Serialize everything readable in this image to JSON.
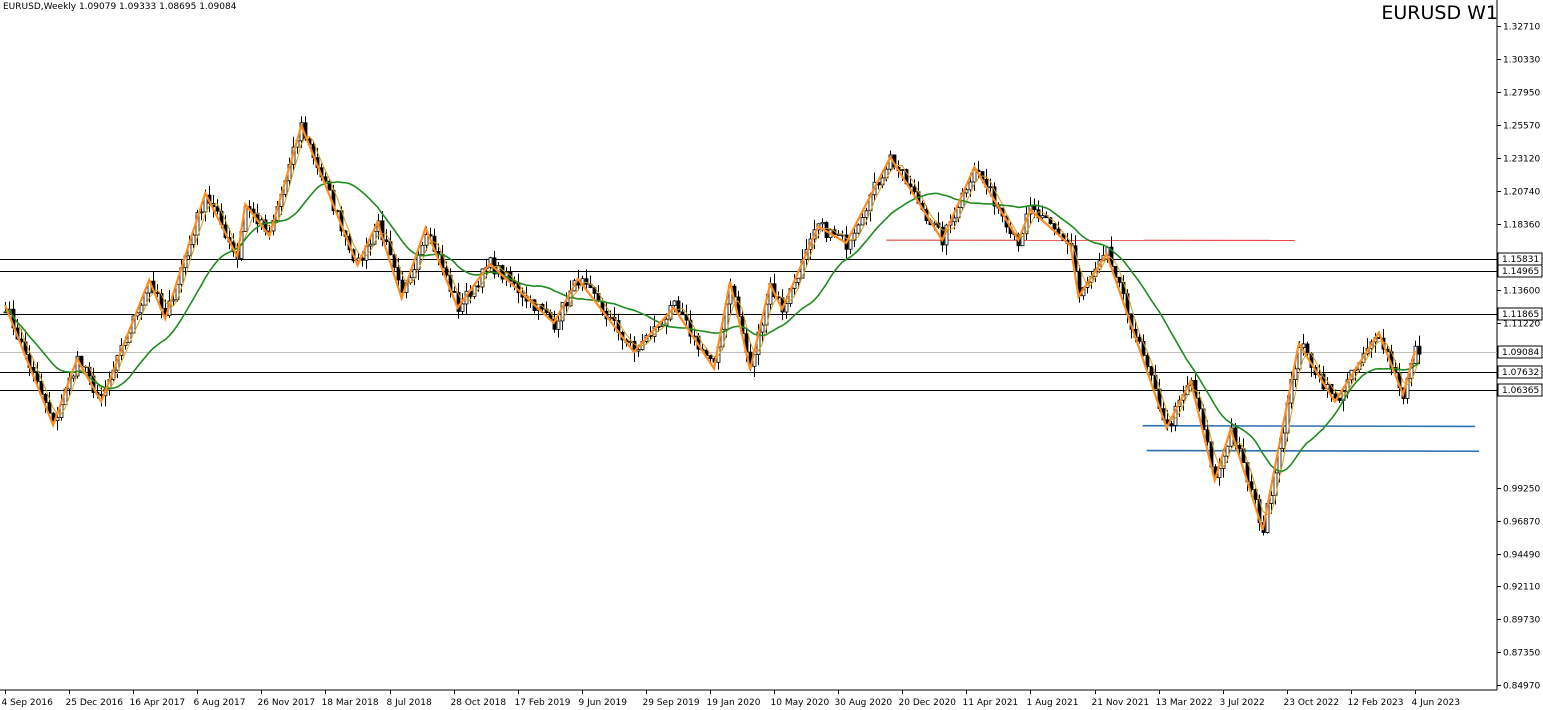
{
  "header": {
    "symbol_line": "EURUSD,Weekly  1.09079 1.09333 1.08695 1.09084",
    "watermark": "EURUSD W1"
  },
  "colors": {
    "candle": "#000000",
    "zigzag": "#ff8c1a",
    "ma_slow": "#1e8c1e",
    "ma_fast": "#d4a017",
    "hline": "#000000",
    "current_line": "#c0c0c0",
    "red_line": "#e03030",
    "blue_line": "#2f6fb0"
  },
  "chart_data": {
    "type": "line",
    "title": "EURUSD W1",
    "ylim": [
      0.846,
      1.346
    ],
    "yticks": [
      "1.32710",
      "1.30330",
      "1.27950",
      "1.25570",
      "1.23120",
      "1.20740",
      "1.18360",
      "1.13600",
      "1.11220",
      "0.99250",
      "0.96870",
      "0.94490",
      "0.92110",
      "0.89730",
      "0.87350",
      "0.84970"
    ],
    "xticks": [
      {
        "label": "4 Sep 2016",
        "t": 0
      },
      {
        "label": "25 Dec 2016",
        "t": 16
      },
      {
        "label": "16 Apr 2017",
        "t": 32
      },
      {
        "label": "6 Aug 2017",
        "t": 48
      },
      {
        "label": "26 Nov 2017",
        "t": 64
      },
      {
        "label": "18 Mar 2018",
        "t": 80
      },
      {
        "label": "8 Jul 2018",
        "t": 96
      },
      {
        "label": "28 Oct 2018",
        "t": 112
      },
      {
        "label": "17 Feb 2019",
        "t": 128
      },
      {
        "label": "9 Jun 2019",
        "t": 144
      },
      {
        "label": "29 Sep 2019",
        "t": 160
      },
      {
        "label": "19 Jan 2020",
        "t": 176
      },
      {
        "label": "10 May 2020",
        "t": 192
      },
      {
        "label": "30 Aug 2020",
        "t": 208
      },
      {
        "label": "20 Dec 2020",
        "t": 224
      },
      {
        "label": "11 Apr 2021",
        "t": 240
      },
      {
        "label": "1 Aug 2021",
        "t": 256
      },
      {
        "label": "21 Nov 2021",
        "t": 272
      },
      {
        "label": "13 Mar 2022",
        "t": 288
      },
      {
        "label": "3 Jul 2022",
        "t": 304
      },
      {
        "label": "23 Oct 2022",
        "t": 320
      },
      {
        "label": "12 Feb 2023",
        "t": 336
      },
      {
        "label": "4 Jun 2023",
        "t": 352
      }
    ],
    "horizontal_levels": [
      {
        "label": "1.15831",
        "value": 1.15831,
        "style": "black",
        "t_start": 0,
        "t_end": 364
      },
      {
        "label": "1.14965",
        "value": 1.14965,
        "style": "black",
        "t_start": 0,
        "t_end": 364
      },
      {
        "label": "1.11865",
        "value": 1.11865,
        "style": "black",
        "t_start": 0,
        "t_end": 364
      },
      {
        "label": "1.09084",
        "value": 1.09084,
        "style": "current",
        "t_start": 0,
        "t_end": 364
      },
      {
        "label": "1.07632",
        "value": 1.07632,
        "style": "black",
        "t_start": 0,
        "t_end": 364
      },
      {
        "label": "1.06365",
        "value": 1.06365,
        "style": "black",
        "t_start": 0,
        "t_end": 364
      }
    ],
    "trend_lines": [
      {
        "style": "red",
        "t1": 220,
        "v1": 1.172,
        "t2": 322,
        "v2": 1.1718
      },
      {
        "style": "blue",
        "t1": 284,
        "v1": 1.0375,
        "t2": 367,
        "v2": 1.037
      },
      {
        "style": "blue",
        "t1": 285,
        "v1": 1.0195,
        "t2": 368,
        "v2": 1.019
      }
    ],
    "pivots": [
      [
        0,
        1.125
      ],
      [
        12,
        1.038
      ],
      [
        18,
        1.086
      ],
      [
        24,
        1.055
      ],
      [
        36,
        1.143
      ],
      [
        40,
        1.115
      ],
      [
        50,
        1.206
      ],
      [
        58,
        1.16
      ],
      [
        60,
        1.198
      ],
      [
        66,
        1.175
      ],
      [
        74,
        1.255
      ],
      [
        88,
        1.154
      ],
      [
        93,
        1.185
      ],
      [
        99,
        1.13
      ],
      [
        105,
        1.181
      ],
      [
        113,
        1.123
      ],
      [
        121,
        1.155
      ],
      [
        137,
        1.112
      ],
      [
        143,
        1.144
      ],
      [
        157,
        1.091
      ],
      [
        167,
        1.123
      ],
      [
        177,
        1.079
      ],
      [
        181,
        1.142
      ],
      [
        186,
        1.078
      ],
      [
        191,
        1.14
      ],
      [
        194,
        1.122
      ],
      [
        203,
        1.182
      ],
      [
        210,
        1.17
      ],
      [
        221,
        1.232
      ],
      [
        234,
        1.172
      ],
      [
        242,
        1.225
      ],
      [
        253,
        1.172
      ],
      [
        256,
        1.194
      ],
      [
        266,
        1.168
      ],
      [
        268,
        1.131
      ],
      [
        275,
        1.162
      ],
      [
        290,
        1.036
      ],
      [
        296,
        1.07
      ],
      [
        302,
        0.998
      ],
      [
        306,
        1.035
      ],
      [
        314,
        0.962
      ],
      [
        323,
        1.097
      ],
      [
        332,
        1.055
      ],
      [
        343,
        1.105
      ],
      [
        349,
        1.06
      ],
      [
        352,
        1.092
      ]
    ],
    "n_bars": 354
  }
}
